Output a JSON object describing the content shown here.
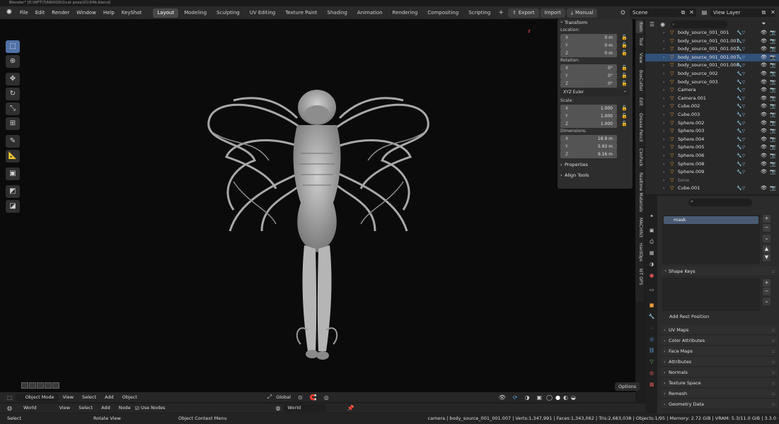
{
  "title": "Blender* [E:\\NFT\\TIANXIOXU\\cat pose\\01\\04b.blend]",
  "menu": [
    "File",
    "Edit",
    "Render",
    "Window",
    "Help",
    "KeyShot"
  ],
  "workspaces": [
    "Layout",
    "Modeling",
    "Sculpting",
    "UV Editing",
    "Texture Paint",
    "Shading",
    "Animation",
    "Rendering",
    "Compositing",
    "Scripting"
  ],
  "active_workspace": "Layout",
  "plus_label": "+",
  "buttons": {
    "export": "Export",
    "import": "Import",
    "manual": "Manual"
  },
  "scene": "Scene",
  "view_layer": "View Layer",
  "transform": {
    "header": "Transform",
    "location_label": "Location:",
    "location": [
      {
        "axis": "X",
        "value": "0 m"
      },
      {
        "axis": "Y",
        "value": "0 m"
      },
      {
        "axis": "Z",
        "value": "0 m"
      }
    ],
    "rotation_label": "Rotation:",
    "rotation": [
      {
        "axis": "X",
        "value": "0°"
      },
      {
        "axis": "Y",
        "value": "0°"
      },
      {
        "axis": "Z",
        "value": "0°"
      }
    ],
    "rotation_mode": "XYZ Euler",
    "scale_label": "Scale:",
    "scale": [
      {
        "axis": "X",
        "value": "1.000"
      },
      {
        "axis": "Y",
        "value": "1.000"
      },
      {
        "axis": "Z",
        "value": "1.000"
      }
    ],
    "dimensions_label": "Dimensions:",
    "dimensions": [
      {
        "axis": "X",
        "value": "16.9 m"
      },
      {
        "axis": "Y",
        "value": "5.93 m"
      },
      {
        "axis": "Z",
        "value": "9.16 m"
      }
    ],
    "properties": "Properties",
    "align_tools": "Align Tools"
  },
  "side_tabs": [
    "Item",
    "Tool",
    "View",
    "BoxCutter",
    "Edit",
    "Grease Pencil",
    "CimPack",
    "Realtime Materials",
    "MACHIN3",
    "HardOps",
    "KIT OPS"
  ],
  "outliner": {
    "rows": [
      {
        "name": "body_source_001_001",
        "selected": false
      },
      {
        "name": "body_source_001_001.001",
        "selected": false
      },
      {
        "name": "body_source_001_001.002",
        "selected": false
      },
      {
        "name": "body_source_001_001.007",
        "selected": true
      },
      {
        "name": "body_source_001_001.008",
        "selected": false
      },
      {
        "name": "body_source_002",
        "selected": false
      },
      {
        "name": "body_source_003",
        "selected": false
      },
      {
        "name": "Camera",
        "selected": false
      },
      {
        "name": "Camera.001",
        "selected": false
      },
      {
        "name": "Cube.002",
        "selected": false
      },
      {
        "name": "Cube.003",
        "selected": false
      },
      {
        "name": "Sphere.002",
        "selected": false
      },
      {
        "name": "Sphere.003",
        "selected": false
      },
      {
        "name": "Sphere.004",
        "selected": false
      },
      {
        "name": "Sphere.005",
        "selected": false
      },
      {
        "name": "Sphere.006",
        "selected": false
      },
      {
        "name": "Sphere.008",
        "selected": false
      },
      {
        "name": "Sphere.009",
        "selected": false
      },
      {
        "name": "bone",
        "selected": false,
        "dim": true
      },
      {
        "name": "Cube.001",
        "selected": false
      }
    ]
  },
  "properties_panel": {
    "vertex_group": "mask",
    "shape_keys": "Shape Keys",
    "add_rest_position": "Add Rest Position",
    "panels": [
      "UV Maps",
      "Color Attributes",
      "Face Maps",
      "Attributes",
      "Normals",
      "Texture Space",
      "Remesh",
      "Geometry Data"
    ]
  },
  "viewport_header": {
    "mode": "Object Mode",
    "menus": [
      "View",
      "Select",
      "Add",
      "Object"
    ],
    "orientation": "Global",
    "options": "Options"
  },
  "node_header": {
    "world_label": "World",
    "menus": [
      "View",
      "Select",
      "Add",
      "Node"
    ],
    "use_nodes": "Use Nodes",
    "world_field": "World"
  },
  "status": {
    "select": "Select",
    "rotate_view": "Rotate View",
    "context_menu": "Object Context Menu",
    "stats": "camera | body_source_001_001.007 | Verts:1,347,991 | Faces:1,343,062 | Tris:2,683,038 | Objects:1/95 | Memory: 2.72 GiB | VRAM: 5.3/11.0 GiB | 3.3.0"
  },
  "gizmo_label": "z",
  "colors": {
    "accent": "#5072a7",
    "selection": "#335078",
    "object_icon": "#e79a3c"
  }
}
